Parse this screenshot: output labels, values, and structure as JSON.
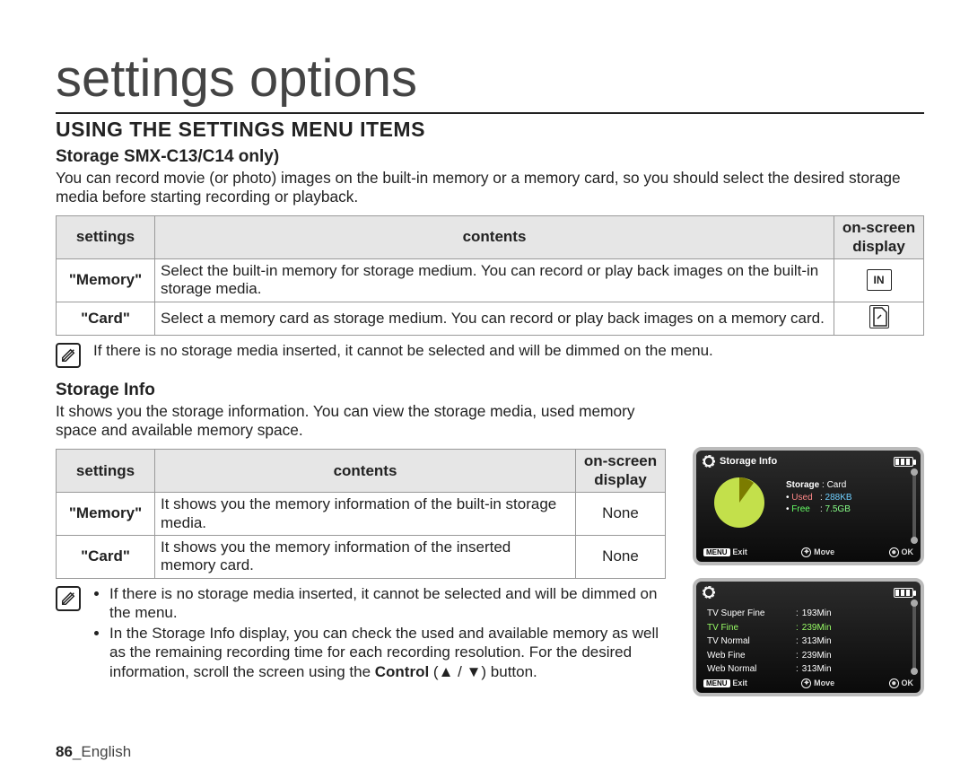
{
  "page_title": "settings options",
  "section_title": "USING THE SETTINGS MENU ITEMS",
  "storage": {
    "title": "Storage SMX-C13/C14 only)",
    "desc": "You can record movie (or photo) images on the built-in memory or a memory card, so you should select the desired storage media before starting recording or playback.",
    "headers": {
      "settings": "settings",
      "contents": "contents",
      "osd": "on-screen display"
    },
    "rows": [
      {
        "setting": "\"Memory\"",
        "content": "Select the built-in memory for storage medium. You can record or play back images on the built-in storage media.",
        "icon": "IN"
      },
      {
        "setting": "\"Card\"",
        "content": "Select a memory card as storage medium. You can record or play back images on a memory card.",
        "icon": "card"
      }
    ],
    "note": "If there is no storage media inserted, it cannot be selected and will be dimmed on the menu."
  },
  "storage_info": {
    "title": "Storage Info",
    "desc": "It shows you the storage information. You can view the storage media, used memory space and available memory space.",
    "headers": {
      "settings": "settings",
      "contents": "contents",
      "osd": "on-screen display"
    },
    "rows": [
      {
        "setting": "\"Memory\"",
        "content": "It shows you the memory information of the built-in storage media.",
        "osd": "None"
      },
      {
        "setting": "\"Card\"",
        "content": "It shows you the memory information of the inserted memory card.",
        "osd": "None"
      }
    ],
    "notes": [
      "If there is no storage media inserted, it cannot be selected and will be dimmed on the menu.",
      "In the Storage Info display, you can check the used and available memory as well as the remaining recording time for each recording resolution. For the desired information, scroll the screen using the Control (▲ / ▼) button."
    ],
    "control_word": "Control"
  },
  "osd1": {
    "title": "Storage Info",
    "storage_label": "Storage",
    "storage_value": "Card",
    "used_label": "Used",
    "used_value": "288KB",
    "free_label": "Free",
    "free_value": "7.5GB",
    "footer": {
      "menu": "MENU",
      "exit": "Exit",
      "move": "Move",
      "ok": "OK"
    }
  },
  "osd2": {
    "items": [
      {
        "label": "TV Super Fine",
        "value": "193Min",
        "sel": false
      },
      {
        "label": "TV Fine",
        "value": "239Min",
        "sel": true
      },
      {
        "label": "TV Normal",
        "value": "313Min",
        "sel": false
      },
      {
        "label": "Web Fine",
        "value": "239Min",
        "sel": false
      },
      {
        "label": "Web Normal",
        "value": "313Min",
        "sel": false
      }
    ],
    "footer": {
      "menu": "MENU",
      "exit": "Exit",
      "move": "Move",
      "ok": "OK"
    }
  },
  "footer": {
    "page": "86",
    "lang": "English"
  },
  "chart_data": {
    "type": "pie",
    "title": "Storage Info",
    "series": [
      {
        "name": "Used",
        "value_label": "288KB",
        "color": "#7c7c00"
      },
      {
        "name": "Free",
        "value_label": "7.5GB",
        "color": "#c3e04b"
      }
    ],
    "annotations": {
      "storage": "Card"
    }
  }
}
